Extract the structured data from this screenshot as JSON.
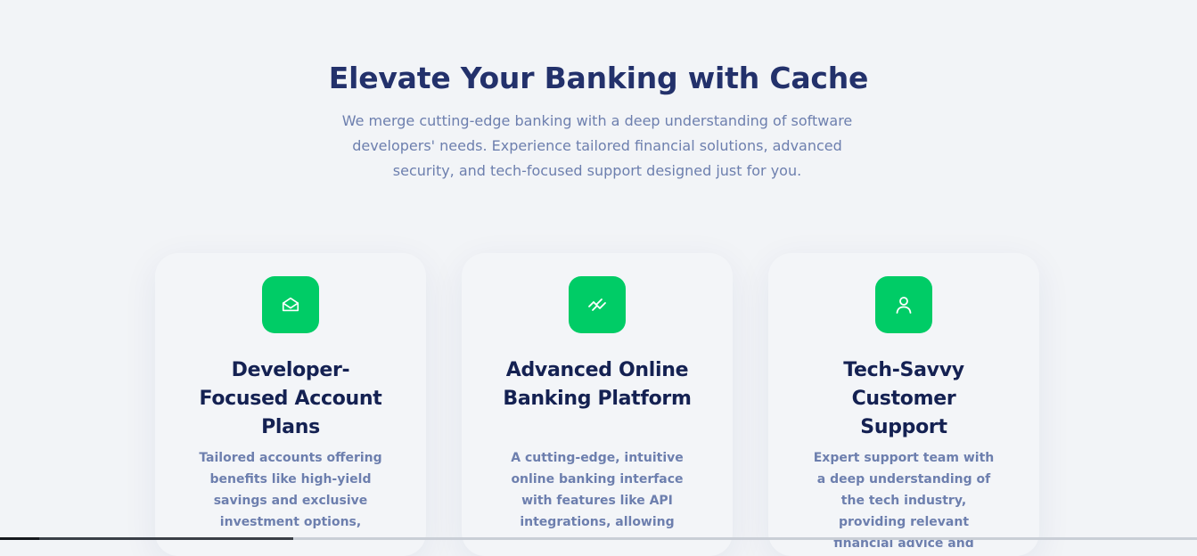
{
  "hero": {
    "title": "Elevate Your Banking with Cache",
    "subtitle": "We merge cutting-edge banking with a deep understanding of software developers' needs. Experience tailored financial solutions, advanced security, and tech-focused support designed just for you."
  },
  "features": [
    {
      "icon": "envelope-open-icon",
      "title": "Developer-Focused Account Plans",
      "description": "Tailored accounts offering benefits like high-yield savings and exclusive investment options,"
    },
    {
      "icon": "trending-lines-icon",
      "title": "Advanced Online Banking Platform",
      "description": "A cutting-edge, intuitive online banking interface with features like API integrations, allowing"
    },
    {
      "icon": "user-icon",
      "title": "Tech-Savvy Customer Support",
      "description": "Expert support team with a deep understanding of the tech industry, providing relevant financial advice and"
    }
  ],
  "colors": {
    "background": "#f2f4f7",
    "heading": "#23316b",
    "card_title": "#142152",
    "body_text": "#6d7fae",
    "accent": "#00cc66"
  }
}
